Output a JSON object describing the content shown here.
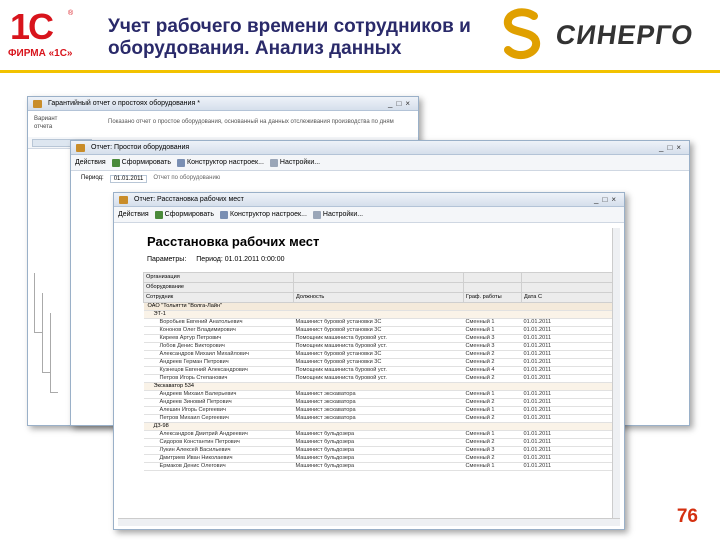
{
  "slide": {
    "title_line1": "Учет рабочего времени сотрудников и",
    "title_line2": "оборудования. Анализ данных",
    "logo_1c": {
      "glyph": "1С",
      "firm": "ФИРМА «1С»",
      "reg": "®"
    },
    "logo_sinergo": "СИНЕРГО",
    "page_number": "76",
    "accent_color": "#f2c200",
    "brand_red": "#d8141c"
  },
  "win_back": {
    "title": "Гарантийный отчет о простоях оборудования *",
    "side_label_1": "Вариант",
    "side_label_2": "отчета",
    "info_text": "Показано отчет о простое оборудования, основанный на данных отслеживания производства по дням"
  },
  "win_mid": {
    "title": "Отчет: Простои оборудования",
    "toolbar": {
      "action": "Действия",
      "form": "Сформировать",
      "settings": "Конструктор настроек...",
      "setup": "Настройки..."
    },
    "param_label": "Период:",
    "param_value": "01.01.2011",
    "param_text": "Отчет по оборудованию"
  },
  "win_front": {
    "title": "Отчет: Расстановка рабочих мест",
    "toolbar": {
      "action": "Действия",
      "form": "Сформировать",
      "settings": "Конструктор настроек...",
      "setup": "Настройки..."
    }
  },
  "report": {
    "title": "Расстановка рабочих мест",
    "param_label": "Параметры:",
    "param_value": "Период: 01.01.2011 0:00:00",
    "header_rows": [
      [
        "Организация",
        "",
        "",
        ""
      ],
      [
        "Оборудование",
        "",
        "",
        ""
      ],
      [
        "Сотрудник",
        "Должность",
        "Граф. работы",
        "Дата С"
      ]
    ],
    "rows": [
      {
        "kind": "group",
        "cells": [
          "ОАО \"Тольятти \"Волга-Лайн\"",
          "",
          "",
          ""
        ]
      },
      {
        "kind": "sub",
        "cells": [
          "ЭТ-1",
          "",
          "",
          ""
        ]
      },
      {
        "kind": "data",
        "cells": [
          "Воробьев Евгений Анатольевич",
          "Машинист буровой установки 3С",
          "Сменный 1",
          "01.01.2011"
        ]
      },
      {
        "kind": "data",
        "cells": [
          "Кононов Олег Владимирович",
          "Машинист буровой установки 3С",
          "Сменный 1",
          "01.01.2011"
        ]
      },
      {
        "kind": "data",
        "cells": [
          "Киреев Артур Петрович",
          "Помощник машиниста буровой уст.",
          "Сменный 3",
          "01.01.2011"
        ]
      },
      {
        "kind": "data",
        "cells": [
          "Лобов Денис Викторович",
          "Помощник машиниста буровой уст.",
          "Сменный 3",
          "01.01.2011"
        ]
      },
      {
        "kind": "data",
        "cells": [
          "Александров Михаил Михайлович",
          "Машинист буровой установки 3С",
          "Сменный 2",
          "01.01.2011"
        ]
      },
      {
        "kind": "data",
        "cells": [
          "Андреев Герман Петрович",
          "Машинист буровой установки 3С",
          "Сменный 2",
          "01.01.2011"
        ]
      },
      {
        "kind": "data",
        "cells": [
          "Кузнецов Евгений Александрович",
          "Помощник машиниста буровой уст.",
          "Сменный 4",
          "01.01.2011"
        ]
      },
      {
        "kind": "data",
        "cells": [
          "Петров Игорь Степанович",
          "Помощник машиниста буровой уст.",
          "Сменный 2",
          "01.01.2011"
        ]
      },
      {
        "kind": "sub",
        "cells": [
          "Экскаватор 534",
          "",
          "",
          ""
        ]
      },
      {
        "kind": "data",
        "cells": [
          "Андреев Михаил Валерьевич",
          "Машинист экскаватора",
          "Сменный 1",
          "01.01.2011"
        ]
      },
      {
        "kind": "data",
        "cells": [
          "Андреев Зиновий Петрович",
          "Машинист экскаватора",
          "Сменный 2",
          "01.01.2011"
        ]
      },
      {
        "kind": "data",
        "cells": [
          "Алешин Игорь Сергеевич",
          "Машинист экскаватора",
          "Сменный 1",
          "01.01.2011"
        ]
      },
      {
        "kind": "data",
        "cells": [
          "Петров Михаил Сергеевич",
          "Машинист экскаватора",
          "Сменный 2",
          "01.01.2011"
        ]
      },
      {
        "kind": "sub",
        "cells": [
          "ДЗ-98",
          "",
          "",
          ""
        ]
      },
      {
        "kind": "data",
        "cells": [
          "Александров Дмитрий Андреевич",
          "Машинист бульдозера",
          "Сменный 1",
          "01.01.2011"
        ]
      },
      {
        "kind": "data",
        "cells": [
          "Сидоров Константин Петрович",
          "Машинист бульдозера",
          "Сменный 2",
          "01.01.2011"
        ]
      },
      {
        "kind": "data",
        "cells": [
          "Лукин Алексей Васильевич",
          "Машинист бульдозера",
          "Сменный 3",
          "01.01.2011"
        ]
      },
      {
        "kind": "data",
        "cells": [
          "Дмитриев Иван Николаевич",
          "Машинист бульдозера",
          "Сменный 2",
          "01.01.2011"
        ]
      },
      {
        "kind": "data",
        "cells": [
          "Ермаков Денис Олегович",
          "Машинист бульдозера",
          "Сменный 1",
          "01.01.2011"
        ]
      }
    ]
  }
}
